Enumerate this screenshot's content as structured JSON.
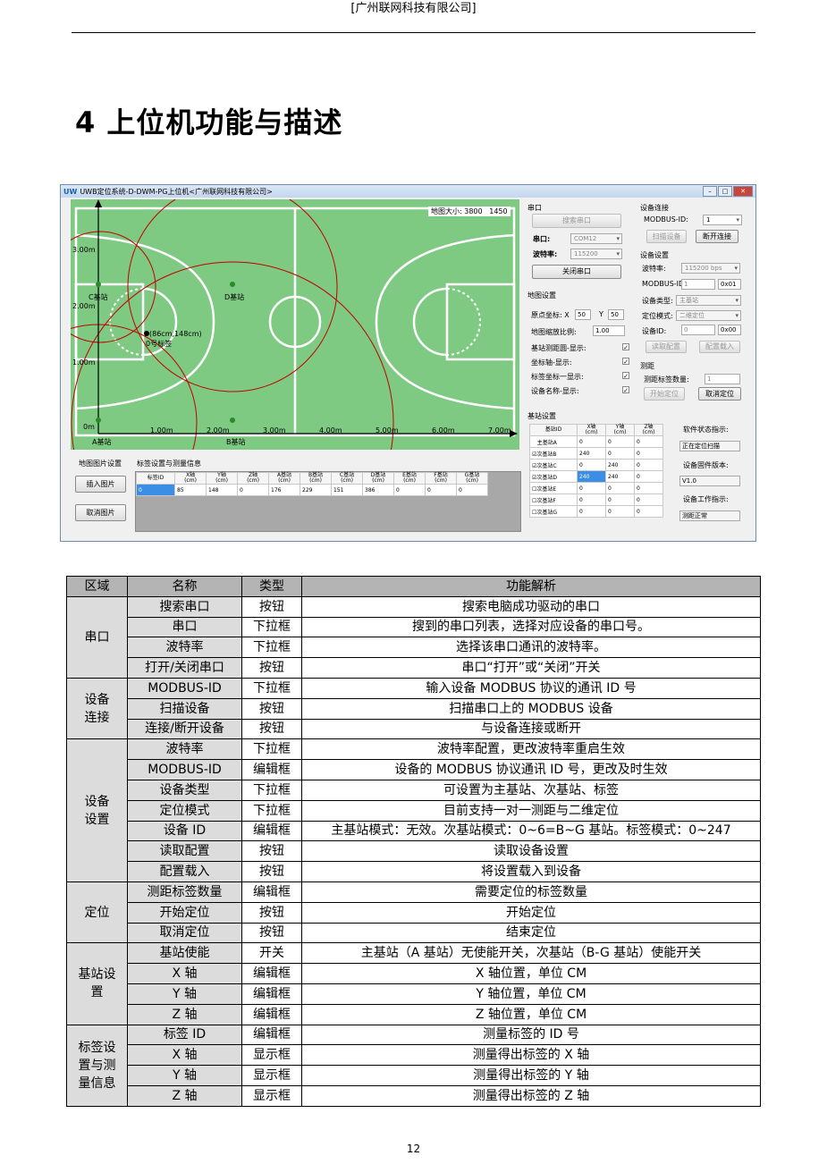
{
  "header": "[广州联网科技有限公司]",
  "title": "4 上位机功能与描述",
  "page_number": "12",
  "app": {
    "window_title": "UWB定位系统-D-DWM-PG上位机<广州联网科技有限公司>",
    "logo": "UW",
    "map_size_label": "地图大小:",
    "map_w": "3800",
    "map_h": "1450",
    "axis_y": [
      "3.00m",
      "2.00m",
      "1.00m",
      "0m"
    ],
    "axis_x": [
      "1.00m",
      "2.00m",
      "3.00m",
      "4.00m",
      "5.00m",
      "6.00m",
      "7.00m"
    ],
    "stations": [
      "C基站",
      "D基站",
      "A基站",
      "B基站"
    ],
    "tag_point": "(86cm,148cm)",
    "tag_name": "0号标签",
    "map_img_group": "地图图片设置",
    "insert_img": "插入图片",
    "cancel_img": "取消图片",
    "tag_group": "标签设置与测量信息",
    "tag_headers": [
      "标签ID",
      "X轴\n(cm)",
      "Y轴\n(cm)",
      "Z轴\n(cm)",
      "A基站\n(cm)",
      "B基站\n(cm)",
      "C基站\n(cm)",
      "D基站\n(cm)",
      "E基站\n(cm)",
      "F基站\n(cm)",
      "G基站\n(cm)"
    ],
    "tag_row": [
      "0",
      "85",
      "148",
      "0",
      "176",
      "229",
      "151",
      "386",
      "0",
      "0",
      "0"
    ],
    "serial_group": "串口",
    "search_port": "搜索串口",
    "port_label": "串口:",
    "port_value": "COM12",
    "baud_label": "波特率:",
    "baud_value": "115200",
    "close_port": "关闭串口",
    "conn_group": "设备连接",
    "modbus_id_label": "MODBUS-ID:",
    "modbus_id_value": "1",
    "scan_device": "扫描设备",
    "disconnect": "断开连接",
    "dev_group": "设备设置",
    "dev_baud_label": "波特率:",
    "dev_baud_value": "115200 bps",
    "dev_modbus_label": "MODBUS-ID:",
    "dev_modbus_value": "1",
    "dev_modbus_hex": "0x01",
    "dev_type_label": "设备类型:",
    "dev_type_value": "主基站",
    "pos_mode_label": "定位模式:",
    "pos_mode_value": "二维定位",
    "dev_id_label": "设备ID:",
    "dev_id_value": "0",
    "dev_id_hex": "0x00",
    "read_cfg": "读取配置",
    "load_cfg": "配置载入",
    "map_group": "地图设置",
    "origin_label": "原点坐标: X",
    "origin_x": "50",
    "origin_y_label": "Y",
    "origin_y": "50",
    "scale_label": "地图缩放比例:",
    "scale_value": "1.00",
    "show_range": "基站测距圆-显示:",
    "show_axis": "坐标轴-显示:",
    "show_tagcoord": "标签坐标一显示:",
    "show_devname": "设备名称-显示:",
    "loc_group": "测距",
    "tag_count_label": "测距标签数量:",
    "tag_count_value": "1",
    "start_loc": "开始定位",
    "cancel_loc": "取消定位",
    "station_group": "基站设置",
    "station_headers": [
      "基站ID",
      "X轴\n(cm)",
      "Y轴\n(cm)",
      "Z轴\n(cm)"
    ],
    "station_rows": [
      [
        "主基站A",
        "0",
        "0",
        "0"
      ],
      [
        "次基站B",
        "240",
        "0",
        "0"
      ],
      [
        "次基站C",
        "0",
        "240",
        "0"
      ],
      [
        "次基站D",
        "240",
        "240",
        "0"
      ],
      [
        "次基站E",
        "0",
        "0",
        "0"
      ],
      [
        "次基站F",
        "0",
        "0",
        "0"
      ],
      [
        "次基站G",
        "0",
        "0",
        "0"
      ]
    ],
    "sw_status_label": "软件状态指示:",
    "sw_status_value": "正在定位扫描",
    "fw_label": "设备固件版本:",
    "fw_value": "V1.0",
    "work_label": "设备工作指示:",
    "work_value": "测距正常"
  },
  "table": {
    "headers": [
      "区域",
      "名称",
      "类型",
      "功能解析"
    ],
    "sections": [
      {
        "area": "串口",
        "rows": [
          [
            "搜索串口",
            "按钮",
            "搜索电脑成功驱动的串口"
          ],
          [
            "串口",
            "下拉框",
            "搜到的串口列表，选择对应设备的串口号。"
          ],
          [
            "波特率",
            "下拉框",
            "选择该串口通讯的波特率。"
          ],
          [
            "打开/关闭串口",
            "按钮",
            "串口“打开”或“关闭”开关"
          ]
        ]
      },
      {
        "area": "设备\n连接",
        "rows": [
          [
            "MODBUS-ID",
            "下拉框",
            "输入设备 MODBUS 协议的通讯 ID 号"
          ],
          [
            "扫描设备",
            "按钮",
            "扫描串口上的 MODBUS 设备"
          ],
          [
            "连接/断开设备",
            "按钮",
            "与设备连接或断开"
          ]
        ]
      },
      {
        "area": "设备\n设置",
        "rows": [
          [
            "波特率",
            "下拉框",
            "波特率配置，更改波特率重启生效"
          ],
          [
            "MODBUS-ID",
            "编辑框",
            "设备的 MODBUS 协议通讯 ID 号，更改及时生效"
          ],
          [
            "设备类型",
            "下拉框",
            "可设置为主基站、次基站、标签"
          ],
          [
            "定位模式",
            "下拉框",
            "目前支持一对一测距与二维定位"
          ],
          [
            "设备 ID",
            "编辑框",
            "主基站模式：无效。次基站模式：0~6=B~G 基站。标签模式：0~247"
          ],
          [
            "读取配置",
            "按钮",
            "读取设备设置"
          ],
          [
            "配置载入",
            "按钮",
            "将设置载入到设备"
          ]
        ]
      },
      {
        "area": "定位",
        "rows": [
          [
            "测距标签数量",
            "编辑框",
            "需要定位的标签数量"
          ],
          [
            "开始定位",
            "按钮",
            "开始定位"
          ],
          [
            "取消定位",
            "按钮",
            "结束定位"
          ]
        ]
      },
      {
        "area": "基站设\n置",
        "rows": [
          [
            "基站使能",
            "开关",
            "主基站（A 基站）无使能开关，次基站（B-G 基站）使能开关"
          ],
          [
            "X 轴",
            "编辑框",
            "X 轴位置，单位 CM"
          ],
          [
            "Y 轴",
            "编辑框",
            "Y 轴位置，单位 CM"
          ],
          [
            "Z 轴",
            "编辑框",
            "Z 轴位置，单位 CM"
          ]
        ]
      },
      {
        "area": "标签设\n置与测\n量信息",
        "rows": [
          [
            "标签 ID",
            "编辑框",
            "测量标签的 ID 号"
          ],
          [
            "X 轴",
            "显示框",
            "测量得出标签的 X 轴"
          ],
          [
            "Y 轴",
            "显示框",
            "测量得出标签的 Y 轴"
          ],
          [
            "Z 轴",
            "显示框",
            "测量得出标签的 Z 轴"
          ]
        ]
      }
    ]
  }
}
